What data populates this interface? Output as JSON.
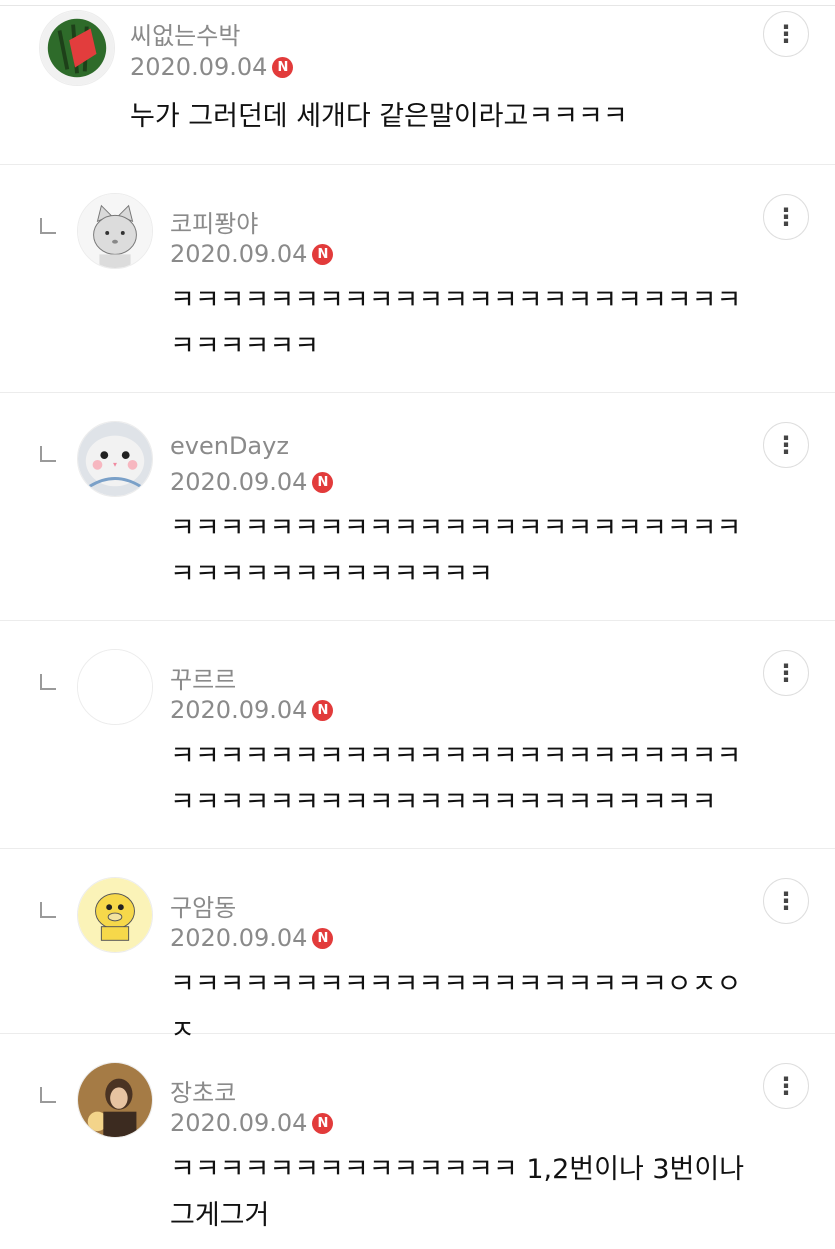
{
  "comments": [
    {
      "nickname": "씨없는수박",
      "date": "2020.09.04",
      "badge": "N",
      "text": "누가 그러던데 세개다 같은말이라고ㅋㅋㅋㅋ",
      "avatar_icon": "watermelon-avatar",
      "is_reply": false
    },
    {
      "nickname": "코피퐝야",
      "date": "2020.09.04",
      "badge": "N",
      "text": "ㅋㅋㅋㅋㅋㅋㅋㅋㅋㅋㅋㅋㅋㅋㅋㅋㅋㅋㅋㅋㅋㅋㅋㅋㅋㅋㅋㅋㅋ",
      "avatar_icon": "gray-cat-avatar",
      "is_reply": true
    },
    {
      "nickname": "evenDayz",
      "date": "2020.09.04",
      "badge": "N",
      "text": "ㅋㅋㅋㅋㅋㅋㅋㅋㅋㅋㅋㅋㅋㅋㅋㅋㅋㅋㅋㅋㅋㅋㅋㅋㅋㅋㅋㅋㅋㅋㅋㅋㅋㅋㅋㅋ",
      "avatar_icon": "hamster-avatar",
      "is_reply": true
    },
    {
      "nickname": "꾸르르",
      "date": "2020.09.04",
      "badge": "N",
      "text": "ㅋㅋㅋㅋㅋㅋㅋㅋㅋㅋㅋㅋㅋㅋㅋㅋㅋㅋㅋㅋㅋㅋㅋㅋㅋㅋㅋㅋㅋㅋㅋㅋㅋㅋㅋㅋㅋㅋㅋㅋㅋㅋㅋㅋㅋ",
      "avatar_icon": "blank-avatar",
      "is_reply": true
    },
    {
      "nickname": "구암동",
      "date": "2020.09.04",
      "badge": "N",
      "text": "ㅋㅋㅋㅋㅋㅋㅋㅋㅋㅋㅋㅋㅋㅋㅋㅋㅋㅋㅋㅋㅇㅈㅇㅈ",
      "avatar_icon": "psyduck-avatar",
      "is_reply": true
    },
    {
      "nickname": "장초코",
      "date": "2020.09.04",
      "badge": "N",
      "text": "ㅋㅋㅋㅋㅋㅋㅋㅋㅋㅋㅋㅋㅋㅋ 1,2번이나 3번이나 그게그거",
      "avatar_icon": "person-photo-avatar",
      "is_reply": true
    }
  ],
  "more_button_icon": "more-vertical-icon",
  "colors": {
    "badge": "#e23b3b",
    "meta_text": "#8a8a8a",
    "divider": "#ececec"
  }
}
